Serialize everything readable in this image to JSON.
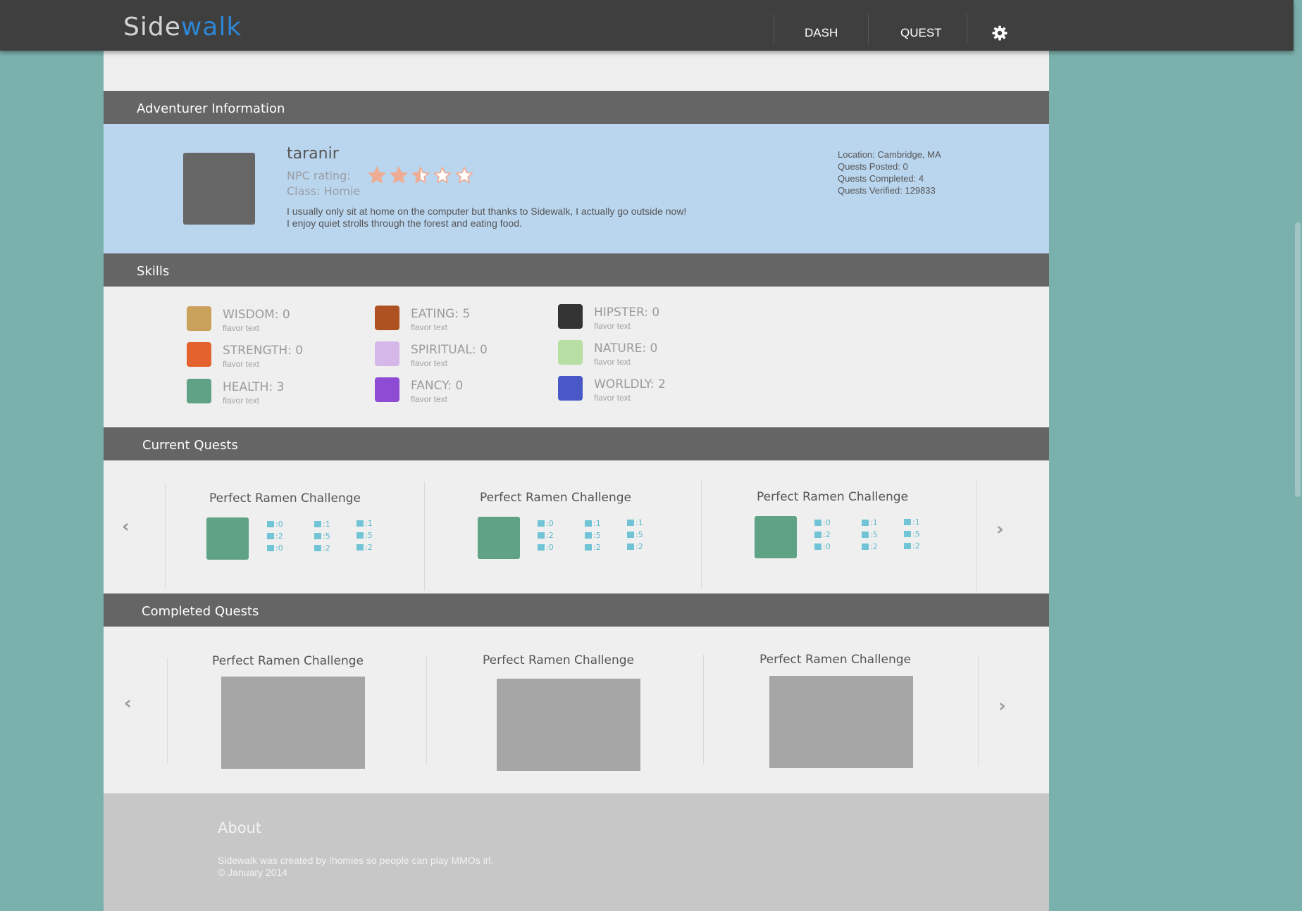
{
  "header": {
    "logo_part1": "Side",
    "logo_part2": "walk",
    "nav": [
      "DASH",
      "QUEST"
    ],
    "settings_icon": "gear-icon",
    "brand_color": "#2e86d6"
  },
  "adventurer": {
    "section_title": "Adventurer Information",
    "username": "taranir",
    "npc_rating_label": "NPC rating:",
    "rating": 2.5,
    "rating_max": 5,
    "class_label": "Class: Homie",
    "bio_line1": "I usually only sit at home on the computer but thanks to Sidewalk, I actually go outside now!",
    "bio_line2": "I enjoy quiet strolls through the forest and eating food.",
    "stats": [
      "Location: Cambridge, MA",
      "Quests Posted: 0",
      "Quests Completed: 4",
      "Quests Verified: 129833"
    ]
  },
  "skills": {
    "section_title": "Skills",
    "items": [
      {
        "label": "WISDOM: 0",
        "flavor": "flavor text",
        "color": "#c9a15a"
      },
      {
        "label": "STRENGTH: 0",
        "flavor": "flavor text",
        "color": "#e3622d"
      },
      {
        "label": "HEALTH: 3",
        "flavor": "flavor text",
        "color": "#5fa285"
      },
      {
        "label": "EATING: 5",
        "flavor": "flavor text",
        "color": "#ad5220"
      },
      {
        "label": "SPIRITUAL: 0",
        "flavor": "flavor text",
        "color": "#d6b7e9"
      },
      {
        "label": "FANCY: 0",
        "flavor": "flavor text",
        "color": "#8e4bd4"
      },
      {
        "label": "HIPSTER: 0",
        "flavor": "flavor text",
        "color": "#333333"
      },
      {
        "label": "NATURE: 0",
        "flavor": "flavor text",
        "color": "#b7dfa3"
      },
      {
        "label": "WORLDLY: 2",
        "flavor": "flavor text",
        "color": "#4858c6"
      }
    ]
  },
  "current_quests": {
    "section_title": "Current Quests",
    "quests": [
      {
        "title": "Perfect Ramen Challenge",
        "stats": [
          ":0",
          ":1",
          ":1",
          ":2",
          ":5",
          ":5",
          ":0",
          ":2",
          ":2"
        ]
      },
      {
        "title": "Perfect Ramen Challenge",
        "stats": [
          ":0",
          ":1",
          ":1",
          ":2",
          ":5",
          ":5",
          ":0",
          ":2",
          ":2"
        ]
      },
      {
        "title": "Perfect Ramen Challenge",
        "stats": [
          ":0",
          ":1",
          ":1",
          ":2",
          ":5",
          ":5",
          ":0",
          ":2",
          ":2"
        ]
      }
    ],
    "prev_arrow": "‹",
    "next_arrow": "›"
  },
  "completed_quests": {
    "section_title": "Completed Quests",
    "quests": [
      {
        "title": "Perfect Ramen Challenge"
      },
      {
        "title": "Perfect Ramen Challenge"
      },
      {
        "title": "Perfect Ramen Challenge"
      }
    ],
    "prev_arrow": "‹",
    "next_arrow": "›"
  },
  "footer": {
    "title": "About",
    "line1": "Sidewalk was created by !homies so people can play MMOs irl.",
    "line2": "© January 2014"
  }
}
